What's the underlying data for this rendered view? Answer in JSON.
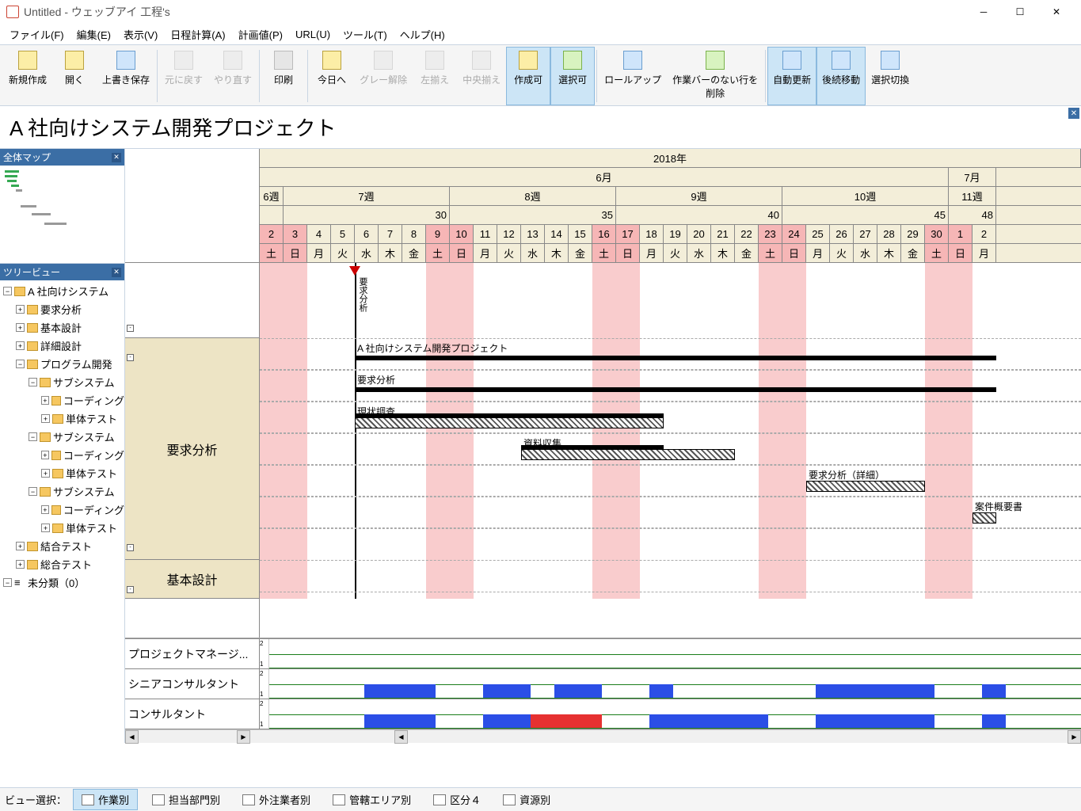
{
  "window": {
    "title": "Untitled - ウェッブアイ 工程's"
  },
  "menu": {
    "file": "ファイル(F)",
    "edit": "編集(E)",
    "view": "表示(V)",
    "schedule": "日程計算(A)",
    "plan": "計画値(P)",
    "url": "URL(U)",
    "tool": "ツール(T)",
    "help": "ヘルプ(H)"
  },
  "toolbar": {
    "new": "新規作成",
    "open": "開く",
    "save": "上書き保存",
    "undo": "元に戻す",
    "redo": "やり直す",
    "print": "印刷",
    "today": "今日へ",
    "gray": "グレー解除",
    "alignL": "左揃え",
    "alignC": "中央揃え",
    "createOk": "作成可",
    "selectOk": "選択可",
    "rollup": "ロールアップ",
    "delEmpty": "作業バーのない行を\n削除",
    "autoUpdate": "自動更新",
    "moveNext": "後続移動",
    "switchSel": "選択切換"
  },
  "projectTitle": "A 社向けシステム開発プロジェクト",
  "panels": {
    "minimap": "全体マップ",
    "tree": "ツリービュー"
  },
  "tree": [
    {
      "ind": 0,
      "exp": "-",
      "label": "A 社向けシステム"
    },
    {
      "ind": 1,
      "exp": "+",
      "label": "要求分析"
    },
    {
      "ind": 1,
      "exp": "+",
      "label": "基本設計"
    },
    {
      "ind": 1,
      "exp": "+",
      "label": "詳細設計"
    },
    {
      "ind": 1,
      "exp": "-",
      "label": "プログラム開発"
    },
    {
      "ind": 2,
      "exp": "-",
      "label": "サブシステム"
    },
    {
      "ind": 3,
      "exp": "+",
      "label": "コーディング"
    },
    {
      "ind": 3,
      "exp": "+",
      "label": "単体テスト"
    },
    {
      "ind": 2,
      "exp": "-",
      "label": "サブシステム"
    },
    {
      "ind": 3,
      "exp": "+",
      "label": "コーディング"
    },
    {
      "ind": 3,
      "exp": "+",
      "label": "単体テスト"
    },
    {
      "ind": 2,
      "exp": "-",
      "label": "サブシステム"
    },
    {
      "ind": 3,
      "exp": "+",
      "label": "コーディング"
    },
    {
      "ind": 3,
      "exp": "+",
      "label": "単体テスト"
    },
    {
      "ind": 1,
      "exp": "+",
      "label": "結合テスト"
    },
    {
      "ind": 1,
      "exp": "+",
      "label": "総合テスト"
    },
    {
      "ind": 0,
      "exp": "-",
      "label": "未分類（0）",
      "nofolder": true
    }
  ],
  "timeline": {
    "year": "2018年",
    "months": [
      {
        "label": "6月",
        "span": 29
      },
      {
        "label": "7月",
        "span": 2
      }
    ],
    "weeks": [
      {
        "label": "6週",
        "span": 1
      },
      {
        "label": "7週",
        "span": 7
      },
      {
        "label": "8週",
        "span": 7
      },
      {
        "label": "9週",
        "span": 7
      },
      {
        "label": "10週",
        "span": 7
      },
      {
        "label": "11週",
        "span": 2
      }
    ],
    "counts": [
      {
        "val": "",
        "span": 1
      },
      {
        "val": "30",
        "span": 7
      },
      {
        "val": "35",
        "span": 7
      },
      {
        "val": "40",
        "span": 7
      },
      {
        "val": "45",
        "span": 7
      },
      {
        "val": "48",
        "span": 2
      }
    ],
    "days": [
      {
        "d": "2",
        "w": "土",
        "we": true
      },
      {
        "d": "3",
        "w": "日",
        "we": true
      },
      {
        "d": "4",
        "w": "月"
      },
      {
        "d": "5",
        "w": "火"
      },
      {
        "d": "6",
        "w": "水"
      },
      {
        "d": "7",
        "w": "木"
      },
      {
        "d": "8",
        "w": "金"
      },
      {
        "d": "9",
        "w": "土",
        "we": true
      },
      {
        "d": "10",
        "w": "日",
        "we": true
      },
      {
        "d": "11",
        "w": "月"
      },
      {
        "d": "12",
        "w": "火"
      },
      {
        "d": "13",
        "w": "水"
      },
      {
        "d": "14",
        "w": "木"
      },
      {
        "d": "15",
        "w": "金"
      },
      {
        "d": "16",
        "w": "土",
        "we": true
      },
      {
        "d": "17",
        "w": "日",
        "we": true
      },
      {
        "d": "18",
        "w": "月"
      },
      {
        "d": "19",
        "w": "火"
      },
      {
        "d": "20",
        "w": "水"
      },
      {
        "d": "21",
        "w": "木"
      },
      {
        "d": "22",
        "w": "金"
      },
      {
        "d": "23",
        "w": "土",
        "we": true
      },
      {
        "d": "24",
        "w": "日",
        "we": true
      },
      {
        "d": "25",
        "w": "月"
      },
      {
        "d": "26",
        "w": "火"
      },
      {
        "d": "27",
        "w": "水"
      },
      {
        "d": "28",
        "w": "木"
      },
      {
        "d": "29",
        "w": "金"
      },
      {
        "d": "30",
        "w": "土",
        "we": true
      },
      {
        "d": "1",
        "w": "日",
        "we": true
      },
      {
        "d": "2",
        "w": "月"
      }
    ]
  },
  "rowGroups": {
    "g1": "要求分析",
    "g2": "基本設計"
  },
  "tasks": {
    "milestone": "要求分析",
    "t0": "A 社向けシステム開発プロジェクト",
    "t1": "要求分析",
    "t2": "現状調査",
    "t3": "資料収集",
    "t4": "要求分析（詳細）",
    "t5": "案件概要書"
  },
  "resources": {
    "r1": "プロジェクトマネージ...",
    "r2": "シニアコンサルタント",
    "r3": "コンサルタント",
    "scale": [
      "2",
      "1"
    ]
  },
  "viewbar": {
    "label": "ビュー選択：",
    "v1": "作業別",
    "v2": "担当部門別",
    "v3": "外注業者別",
    "v4": "管轄エリア別",
    "v5": "区分４",
    "v6": "資源別"
  },
  "chart_data": {
    "type": "gantt",
    "title": "A 社向けシステム開発プロジェクト",
    "date_axis": {
      "year": 2018,
      "start": "2018-06-02",
      "end": "2018-07-02"
    },
    "milestones": [
      {
        "name": "要求分析",
        "date": "2018-06-06"
      }
    ],
    "tasks": [
      {
        "name": "A 社向けシステム開発プロジェクト",
        "start": "2018-06-06",
        "end": "2018-07-02",
        "type": "summary"
      },
      {
        "name": "要求分析",
        "start": "2018-06-06",
        "end": "2018-07-02",
        "type": "summary"
      },
      {
        "name": "現状調査",
        "start": "2018-06-06",
        "end": "2018-06-19",
        "progress": 100
      },
      {
        "name": "資料収集",
        "start": "2018-06-13",
        "end": "2018-06-22",
        "progress": 60
      },
      {
        "name": "要求分析（詳細）",
        "start": "2018-06-25",
        "end": "2018-06-29",
        "progress": 0
      },
      {
        "name": "案件概要書",
        "start": "2018-07-02",
        "end": "2018-07-02",
        "progress": 0
      }
    ],
    "resource_load": {
      "プロジェクトマネージャー": {
        "max": 2,
        "blocks": []
      },
      "シニアコンサルタント": {
        "max": 2,
        "blocks": [
          {
            "start": "2018-06-06",
            "end": "2018-06-08",
            "level": 1
          },
          {
            "start": "2018-06-11",
            "end": "2018-06-12",
            "level": 1
          },
          {
            "start": "2018-06-14",
            "end": "2018-06-15",
            "level": 1
          },
          {
            "start": "2018-06-18",
            "end": "2018-06-18",
            "level": 1
          },
          {
            "start": "2018-06-25",
            "end": "2018-06-29",
            "level": 1
          }
        ]
      },
      "コンサルタント": {
        "max": 2,
        "blocks": [
          {
            "start": "2018-06-06",
            "end": "2018-06-08",
            "level": 1
          },
          {
            "start": "2018-06-11",
            "end": "2018-06-12",
            "level": 1
          },
          {
            "start": "2018-06-13",
            "end": "2018-06-15",
            "level": 2,
            "over": true
          },
          {
            "start": "2018-06-18",
            "end": "2018-06-19",
            "level": 1
          },
          {
            "start": "2018-06-20",
            "end": "2018-06-22",
            "level": 1
          },
          {
            "start": "2018-06-25",
            "end": "2018-06-29",
            "level": 1
          }
        ]
      }
    }
  }
}
